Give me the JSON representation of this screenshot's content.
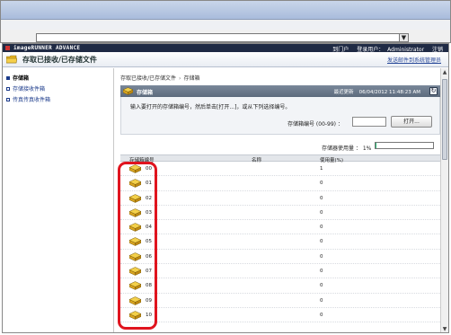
{
  "browser": {
    "address_dropdown": "▼"
  },
  "header": {
    "product": "imageRUNNER ADVANCE",
    "portal_link": "到门户",
    "login_user_label": "登录用户：",
    "login_user": "Administrator",
    "logout_link": "注销"
  },
  "titlebar": {
    "title": "存取已接收/已存储文件",
    "link": "发送邮件到系统管理员"
  },
  "sidebar": {
    "items": [
      {
        "label": "存储箱",
        "active": true
      },
      {
        "label": "存储接收件箱",
        "active": false
      },
      {
        "label": "传真传真收件箱",
        "active": false
      }
    ]
  },
  "breadcrumb": {
    "parent": "存取已接收/已存储文件",
    "current": "存储箱"
  },
  "panel": {
    "title": "存储箱",
    "last_updated_label": "最近更新",
    "timestamp": "06/04/2012 11:48:23 AM",
    "refresh_icon": "↻",
    "instruction": "输入要打开的存储箱编号，然后单击[打开...]，或从下列选择编号。",
    "box_number_label": "存储箱编号 (00-99) ：",
    "box_number_value": "",
    "open_button": "打开..."
  },
  "usage": {
    "label": "存储器使用量 ： 1%",
    "percent": 1
  },
  "table": {
    "headers": {
      "number": "存储箱编号",
      "name": "名称",
      "usage": "使用量(%)"
    },
    "rows": [
      {
        "number": "00",
        "usage": "1"
      },
      {
        "number": "01",
        "usage": "0"
      },
      {
        "number": "02",
        "usage": "0"
      },
      {
        "number": "03",
        "usage": "0"
      },
      {
        "number": "04",
        "usage": "0"
      },
      {
        "number": "05",
        "usage": "0"
      },
      {
        "number": "06",
        "usage": "0"
      },
      {
        "number": "07",
        "usage": "0"
      },
      {
        "number": "08",
        "usage": "0"
      },
      {
        "number": "09",
        "usage": "0"
      },
      {
        "number": "10",
        "usage": "0"
      }
    ]
  },
  "colors": {
    "highlight": "#e0141e",
    "usage_fill": "#2bb673",
    "header_bg": "#1f2a44",
    "link": "#1a3a8a"
  }
}
